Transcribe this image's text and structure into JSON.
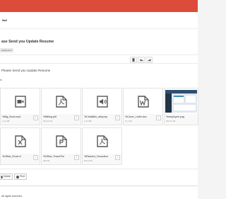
{
  "mailbox": {
    "folder": "Mail"
  },
  "message": {
    "subject": "ase Send you Update Resume",
    "from": "ivainly.com",
    "body": "Please Send you Update Resume"
  },
  "attachments_label": "ts",
  "toolbar": {
    "icons": [
      "trash-icon",
      "reply-icon",
      "forward-icon"
    ]
  },
  "attachments": [
    {
      "name": "%Big_Buck.mp4",
      "size": "4.21 MB",
      "icon": "video-icon"
    },
    {
      "name": "%Billing.pdf",
      "size": "600.02 KB",
      "icon": "pdf-icon"
    },
    {
      "name": "%Chatkiller_alley.mp",
      "size": "1.61 MB",
      "icon": "audio-icon"
    },
    {
      "name": "%Cover_Letter.doc",
      "size": "27.4 KB",
      "icon": "word-icon"
    },
    {
      "name": "%employee.png",
      "size": "200.01 KB",
      "icon": "image-thumbnail"
    },
    {
      "name": "%Office_Excel.xl",
      "size": "",
      "icon": "excel-icon"
    },
    {
      "name": "%Office_PowerPoi",
      "size": "465 KB",
      "icon": "powerpoint-icon"
    },
    {
      "name": "%Rashed_Chowdbur",
      "size": "600.6 KB",
      "icon": "pdf-icon"
    }
  ],
  "actions": {
    "delete": "Delete",
    "print": "Print"
  },
  "footer": {
    "text": "All rights reserved."
  },
  "colors": {
    "header": "#dd4b39",
    "icon": "#555555"
  }
}
